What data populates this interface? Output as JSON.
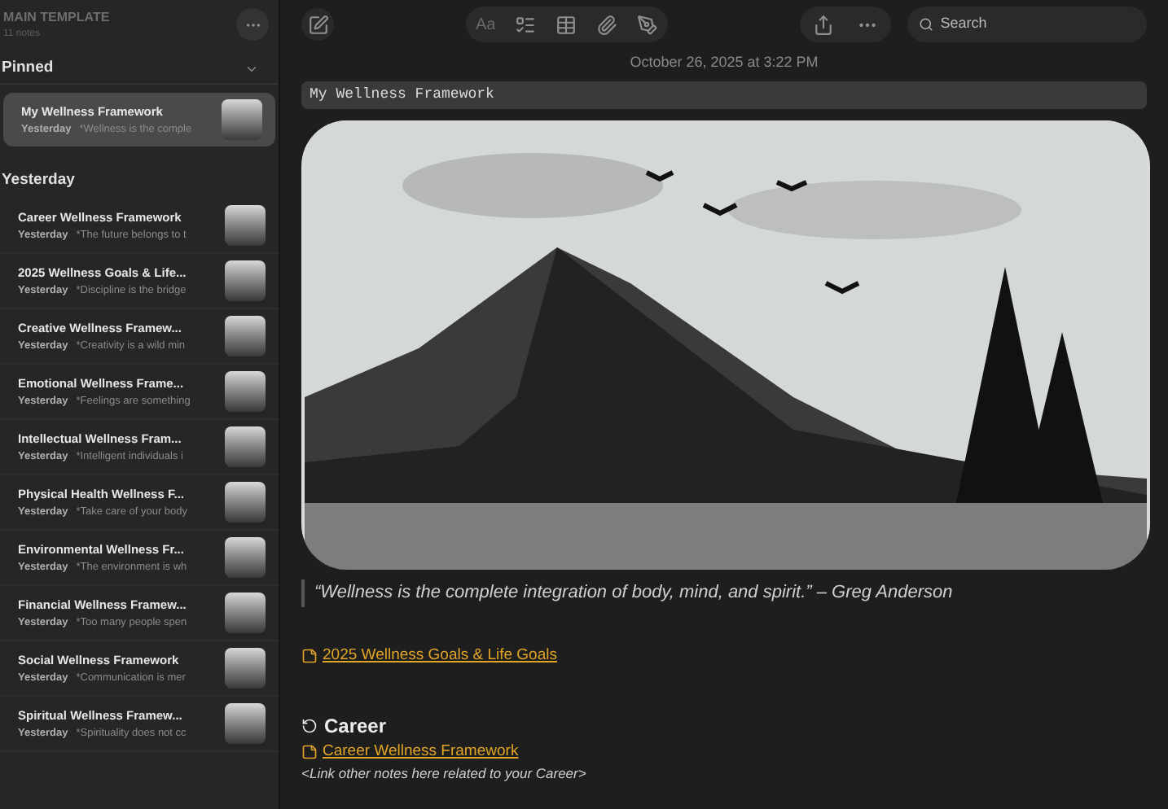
{
  "sidebar": {
    "folder_title": "MAIN TEMPLATE",
    "note_count": "11 notes",
    "sections": [
      {
        "title": "Pinned",
        "expanded": true,
        "notes": [
          {
            "title": "My Wellness Framework",
            "date": "Yesterday",
            "preview": "*Wellness is the comple",
            "selected": true
          }
        ]
      },
      {
        "title": "Yesterday",
        "notes": [
          {
            "title": "Career Wellness Framework",
            "date": "Yesterday",
            "preview": "*The future belongs to t",
            "selected": false
          },
          {
            "title": "2025 Wellness Goals & Life...",
            "date": "Yesterday",
            "preview": "*Discipline is the bridge",
            "selected": false
          },
          {
            "title": "Creative Wellness Framew...",
            "date": "Yesterday",
            "preview": "*Creativity is a wild min",
            "selected": false
          },
          {
            "title": "Emotional Wellness Frame...",
            "date": "Yesterday",
            "preview": "*Feelings are something",
            "selected": false
          },
          {
            "title": "Intellectual Wellness Fram...",
            "date": "Yesterday",
            "preview": "*Intelligent individuals i",
            "selected": false
          },
          {
            "title": "Physical Health Wellness F...",
            "date": "Yesterday",
            "preview": "*Take care of your body",
            "selected": false
          },
          {
            "title": "Environmental Wellness Fr...",
            "date": "Yesterday",
            "preview": "*The environment is wh",
            "selected": false
          },
          {
            "title": "Financial Wellness Framew...",
            "date": "Yesterday",
            "preview": "*Too many people spen",
            "selected": false
          },
          {
            "title": "Social Wellness Framework",
            "date": "Yesterday",
            "preview": "*Communication is mer",
            "selected": false
          },
          {
            "title": "Spiritual Wellness Framew...",
            "date": "Yesterday",
            "preview": "*Spirituality does not cc",
            "selected": false
          }
        ]
      }
    ]
  },
  "toolbar": {
    "format_label": "Aa",
    "search_placeholder": "Search"
  },
  "note": {
    "timestamp": "October 26, 2025 at 3:22 PM",
    "title": "My Wellness Framework",
    "quote": "“Wellness is the complete integration of body, mind, and spirit.” – Greg Anderson",
    "link": "2025 Wellness Goals & Life Goals",
    "heading": "Career",
    "heading_link": "Career Wellness Framework",
    "placeholder_text": "<Link other notes here related to your Career>"
  }
}
